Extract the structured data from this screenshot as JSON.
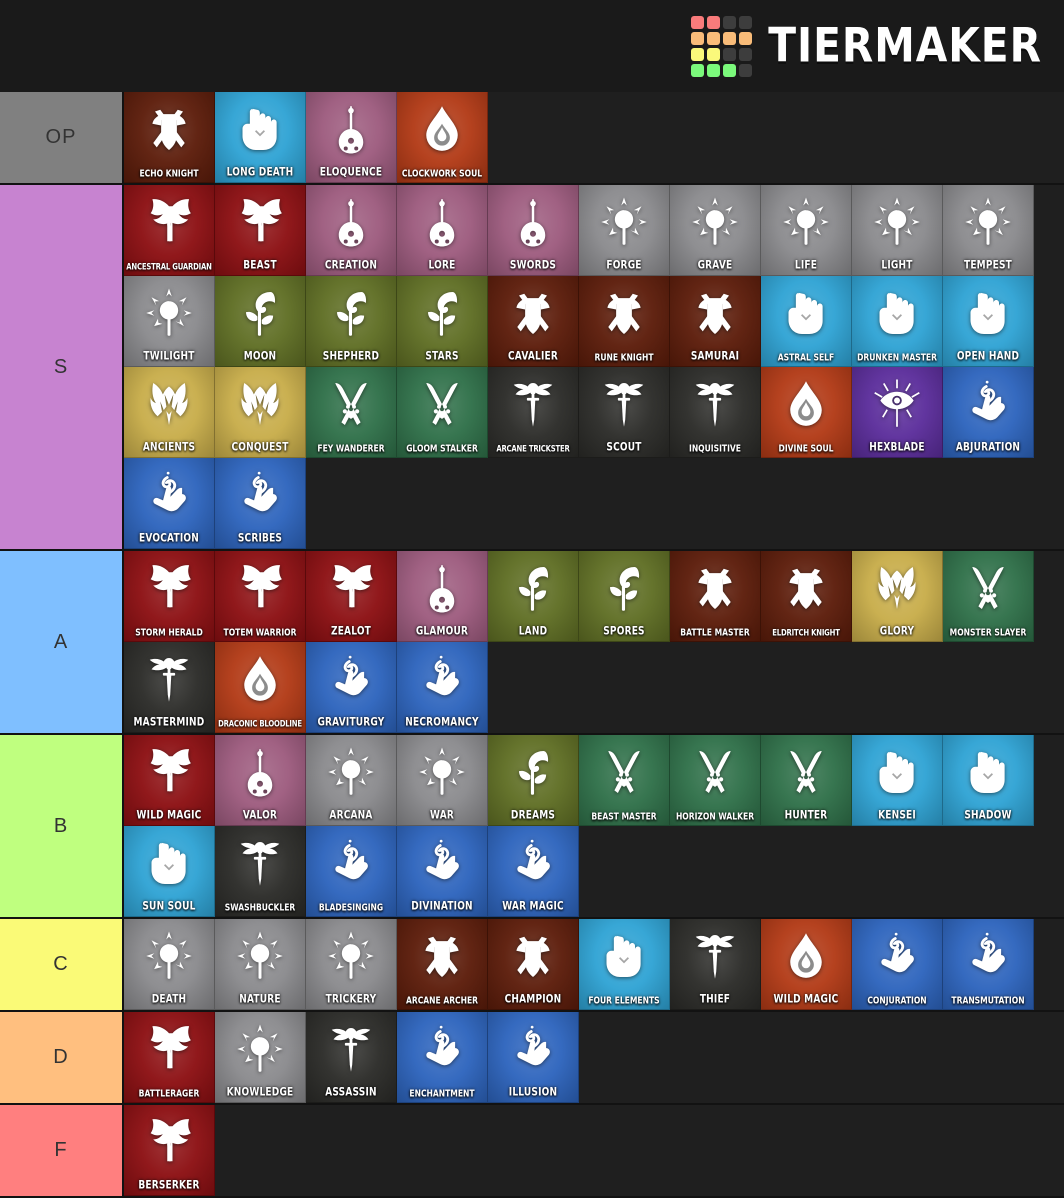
{
  "brand": {
    "name": "TIERMAKER",
    "logo_icon": "tiermaker-grid-logo",
    "grid_colors": [
      "#f97b7b",
      "#f97b7b",
      "#3d3d3d",
      "#3d3d3d",
      "#f9bc79",
      "#f9bc79",
      "#f9bc79",
      "#f9bc79",
      "#faf97b",
      "#faf97b",
      "#3d3d3d",
      "#3d3d3d",
      "#7bf97b",
      "#7bf97b",
      "#7bf97b",
      "#3d3d3d"
    ]
  },
  "tier_colors": {
    "OP": "#808080",
    "S": "#c783d0",
    "A": "#7fbfff",
    "B": "#bfff7f",
    "C": "#fafa77",
    "D": "#ffbf7f",
    "F": "#ff7f7f"
  },
  "class_colors": {
    "barbarian": "#8c0f12",
    "bard": "#9d5b7e",
    "cleric": "#8a8a8d",
    "druid": "#5f6e24",
    "fighter": "#5c1c0a",
    "monk": "#2fa3d4",
    "paladin": "#c8ad4a",
    "ranger": "#2f7049",
    "rogue": "#2b2b28",
    "sorcerer": "#b23a16",
    "warlock": "#5b2d9b",
    "wizard": "#2d64bd",
    "artificer": "#b23a16"
  },
  "tiers": [
    {
      "label": "OP",
      "color_key": "OP",
      "items": [
        {
          "label": "Echo Knight",
          "icon": "fighter-shield-axe-sword-icon",
          "cls": "fighter"
        },
        {
          "label": "Long Death",
          "icon": "monk-fist-icon",
          "cls": "monk"
        },
        {
          "label": "Eloquence",
          "icon": "bard-lute-icon",
          "cls": "bard"
        },
        {
          "label": "Clockwork Soul",
          "icon": "sorcerer-flame-drop-icon",
          "cls": "sorcerer"
        }
      ]
    },
    {
      "label": "S",
      "color_key": "S",
      "items": [
        {
          "label": "Ancestral Guardian",
          "icon": "barbarian-axe-icon",
          "cls": "barbarian"
        },
        {
          "label": "Beast",
          "icon": "barbarian-axe-icon",
          "cls": "barbarian"
        },
        {
          "label": "Creation",
          "icon": "bard-lute-icon",
          "cls": "bard"
        },
        {
          "label": "Lore",
          "icon": "bard-lute-icon",
          "cls": "bard"
        },
        {
          "label": "Swords",
          "icon": "bard-lute-icon",
          "cls": "bard"
        },
        {
          "label": "Forge",
          "icon": "cleric-mace-icon",
          "cls": "cleric"
        },
        {
          "label": "Grave",
          "icon": "cleric-mace-icon",
          "cls": "cleric"
        },
        {
          "label": "Life",
          "icon": "cleric-mace-icon",
          "cls": "cleric"
        },
        {
          "label": "Light",
          "icon": "cleric-mace-icon",
          "cls": "cleric"
        },
        {
          "label": "Tempest",
          "icon": "cleric-mace-icon",
          "cls": "cleric"
        },
        {
          "label": "Twilight",
          "icon": "cleric-mace-icon",
          "cls": "cleric"
        },
        {
          "label": "Moon",
          "icon": "druid-staff-icon",
          "cls": "druid"
        },
        {
          "label": "Shepherd",
          "icon": "druid-staff-icon",
          "cls": "druid"
        },
        {
          "label": "Stars",
          "icon": "druid-staff-icon",
          "cls": "druid"
        },
        {
          "label": "Cavalier",
          "icon": "fighter-shield-axe-sword-icon",
          "cls": "fighter"
        },
        {
          "label": "Rune Knight",
          "icon": "fighter-shield-axe-sword-icon",
          "cls": "fighter"
        },
        {
          "label": "Samurai",
          "icon": "fighter-shield-axe-sword-icon",
          "cls": "fighter"
        },
        {
          "label": "Astral Self",
          "icon": "monk-fist-icon",
          "cls": "monk"
        },
        {
          "label": "Drunken Master",
          "icon": "monk-fist-icon",
          "cls": "monk"
        },
        {
          "label": "Open Hand",
          "icon": "monk-fist-icon",
          "cls": "monk"
        },
        {
          "label": "Ancients",
          "icon": "paladin-helm-icon",
          "cls": "paladin"
        },
        {
          "label": "Conquest",
          "icon": "paladin-helm-icon",
          "cls": "paladin"
        },
        {
          "label": "Fey Wanderer",
          "icon": "ranger-arrows-paw-icon",
          "cls": "ranger"
        },
        {
          "label": "Gloom Stalker",
          "icon": "ranger-arrows-paw-icon",
          "cls": "ranger"
        },
        {
          "label": "Arcane Trickster",
          "icon": "rogue-winged-dagger-icon",
          "cls": "rogue"
        },
        {
          "label": "Scout",
          "icon": "rogue-winged-dagger-icon",
          "cls": "rogue"
        },
        {
          "label": "Inquisitive",
          "icon": "rogue-winged-dagger-icon",
          "cls": "rogue"
        },
        {
          "label": "Divine Soul",
          "icon": "sorcerer-flame-drop-icon",
          "cls": "sorcerer"
        },
        {
          "label": "Hexblade",
          "icon": "warlock-eye-icon",
          "cls": "warlock"
        },
        {
          "label": "Abjuration",
          "icon": "wizard-hand-swirl-icon",
          "cls": "wizard"
        },
        {
          "label": "Evocation",
          "icon": "wizard-hand-swirl-icon",
          "cls": "wizard"
        },
        {
          "label": "Scribes",
          "icon": "wizard-hand-swirl-icon",
          "cls": "wizard"
        }
      ]
    },
    {
      "label": "A",
      "color_key": "A",
      "items": [
        {
          "label": "Storm Herald",
          "icon": "barbarian-axe-icon",
          "cls": "barbarian"
        },
        {
          "label": "Totem Warrior",
          "icon": "barbarian-axe-icon",
          "cls": "barbarian"
        },
        {
          "label": "Zealot",
          "icon": "barbarian-axe-icon",
          "cls": "barbarian"
        },
        {
          "label": "Glamour",
          "icon": "bard-lute-icon",
          "cls": "bard"
        },
        {
          "label": "Land",
          "icon": "druid-staff-icon",
          "cls": "druid"
        },
        {
          "label": "Spores",
          "icon": "druid-staff-icon",
          "cls": "druid"
        },
        {
          "label": "Battle Master",
          "icon": "fighter-shield-axe-sword-icon",
          "cls": "fighter"
        },
        {
          "label": "Eldritch Knight",
          "icon": "fighter-shield-axe-sword-icon",
          "cls": "fighter"
        },
        {
          "label": "Glory",
          "icon": "paladin-helm-icon",
          "cls": "paladin"
        },
        {
          "label": "Monster Slayer",
          "icon": "ranger-arrows-paw-icon",
          "cls": "ranger"
        },
        {
          "label": "Mastermind",
          "icon": "rogue-winged-dagger-icon",
          "cls": "rogue"
        },
        {
          "label": "Draconic Bloodline",
          "icon": "sorcerer-flame-drop-icon",
          "cls": "sorcerer"
        },
        {
          "label": "Graviturgy",
          "icon": "wizard-hand-swirl-icon",
          "cls": "wizard"
        },
        {
          "label": "Necromancy",
          "icon": "wizard-hand-swirl-icon",
          "cls": "wizard"
        }
      ]
    },
    {
      "label": "B",
      "color_key": "B",
      "items": [
        {
          "label": "Wild Magic",
          "icon": "barbarian-axe-icon",
          "cls": "barbarian"
        },
        {
          "label": "Valor",
          "icon": "bard-lute-icon",
          "cls": "bard"
        },
        {
          "label": "Arcana",
          "icon": "cleric-mace-icon",
          "cls": "cleric"
        },
        {
          "label": "War",
          "icon": "cleric-mace-icon",
          "cls": "cleric"
        },
        {
          "label": "Dreams",
          "icon": "druid-staff-icon",
          "cls": "druid"
        },
        {
          "label": "Beast Master",
          "icon": "ranger-arrows-paw-icon",
          "cls": "ranger"
        },
        {
          "label": "Horizon Walker",
          "icon": "ranger-arrows-paw-icon",
          "cls": "ranger"
        },
        {
          "label": "Hunter",
          "icon": "ranger-arrows-paw-icon",
          "cls": "ranger"
        },
        {
          "label": "Kensei",
          "icon": "monk-fist-icon",
          "cls": "monk"
        },
        {
          "label": "Shadow",
          "icon": "monk-fist-icon",
          "cls": "monk"
        },
        {
          "label": "Sun Soul",
          "icon": "monk-fist-icon",
          "cls": "monk"
        },
        {
          "label": "Swashbuckler",
          "icon": "rogue-winged-dagger-icon",
          "cls": "rogue"
        },
        {
          "label": "Bladesinging",
          "icon": "wizard-hand-swirl-icon",
          "cls": "wizard"
        },
        {
          "label": "Divination",
          "icon": "wizard-hand-swirl-icon",
          "cls": "wizard"
        },
        {
          "label": "War Magic",
          "icon": "wizard-hand-swirl-icon",
          "cls": "wizard"
        }
      ]
    },
    {
      "label": "C",
      "color_key": "C",
      "items": [
        {
          "label": "Death",
          "icon": "cleric-mace-icon",
          "cls": "cleric"
        },
        {
          "label": "Nature",
          "icon": "cleric-mace-icon",
          "cls": "cleric"
        },
        {
          "label": "Trickery",
          "icon": "cleric-mace-icon",
          "cls": "cleric"
        },
        {
          "label": "Arcane Archer",
          "icon": "fighter-shield-axe-sword-icon",
          "cls": "fighter"
        },
        {
          "label": "Champion",
          "icon": "fighter-shield-axe-sword-icon",
          "cls": "fighter"
        },
        {
          "label": "Four Elements",
          "icon": "monk-fist-icon",
          "cls": "monk"
        },
        {
          "label": "Thief",
          "icon": "rogue-winged-dagger-icon",
          "cls": "rogue"
        },
        {
          "label": "Wild Magic",
          "icon": "sorcerer-flame-drop-icon",
          "cls": "sorcerer"
        },
        {
          "label": "Conjuration",
          "icon": "wizard-hand-swirl-icon",
          "cls": "wizard"
        },
        {
          "label": "Transmutation",
          "icon": "wizard-hand-swirl-icon",
          "cls": "wizard"
        }
      ]
    },
    {
      "label": "D",
      "color_key": "D",
      "items": [
        {
          "label": "Battlerager",
          "icon": "barbarian-axe-icon",
          "cls": "barbarian"
        },
        {
          "label": "Knowledge",
          "icon": "cleric-mace-icon",
          "cls": "cleric"
        },
        {
          "label": "Assassin",
          "icon": "rogue-winged-dagger-icon",
          "cls": "rogue"
        },
        {
          "label": "Enchantment",
          "icon": "wizard-hand-swirl-icon",
          "cls": "wizard"
        },
        {
          "label": "Illusion",
          "icon": "wizard-hand-swirl-icon",
          "cls": "wizard"
        }
      ]
    },
    {
      "label": "F",
      "color_key": "F",
      "items": [
        {
          "label": "Berserker",
          "icon": "barbarian-axe-icon",
          "cls": "barbarian"
        }
      ]
    }
  ]
}
